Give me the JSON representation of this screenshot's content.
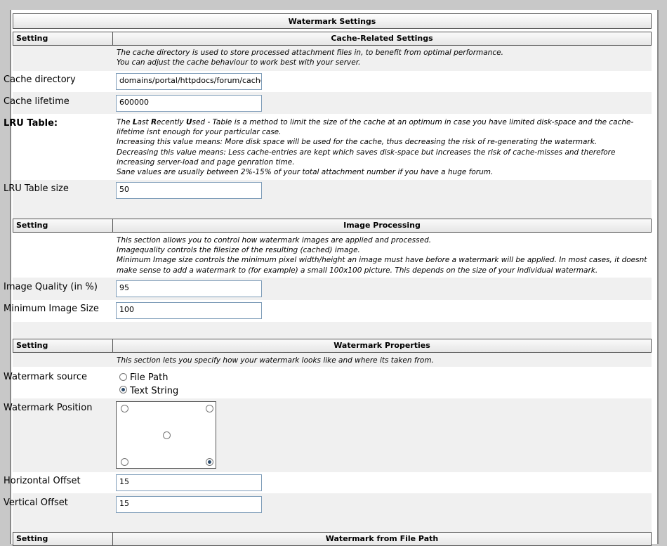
{
  "title": "Watermark Settings",
  "column_setting": "Setting",
  "cache": {
    "header": "Cache-Related Settings",
    "desc_line1": "The cache directory is used to store processed attachment files in, to benefit from optimal performance.",
    "desc_line2": "You can adjust the cache behaviour to work best with your server.",
    "dir_label": "Cache directory",
    "dir_value": "domains/portal/httpdocs/forum/cache",
    "lifetime_label": "Cache lifetime",
    "lifetime_value": "600000",
    "lru_label": "LRU Table:",
    "lru_desc_pre": "The ",
    "lru_l": "L",
    "lru_ast": "ast ",
    "lru_r": "R",
    "lru_ecently": "ecently ",
    "lru_u": "U",
    "lru_sed": "sed",
    "lru_desc_post": " - Table is a method to limit the size of the cache at an optimum in case you have limited disk-space and the cache-",
    "lru_line2": "lifetime isnt enough for your particular case.",
    "lru_line3": "Increasing this value means: More disk space will be used for the cache, thus decreasing the risk of re-generating the watermark.",
    "lru_line4": "Decreasing this value means: Less cache-entries are kept which saves disk-space but increases the risk of cache-misses and therefore",
    "lru_line5": "increasing server-load and page genration time.",
    "lru_line6": "Sane values are usually between 2%-15% of your total attachment number if you have a huge forum.",
    "lru_size_label": "LRU Table size",
    "lru_size_value": "50"
  },
  "image": {
    "header": "Image Processing",
    "desc_line1": "This section allows you to control how watermark images are applied and processed.",
    "desc_line2": "Imagequality controls the filesize of the resulting (cached) image.",
    "desc_line3": "Minimum Image size controls the minimum pixel width/height an image must have before a watermark will be applied. In most cases, it doesnt",
    "desc_line4": "make sense to add a watermark to (for example) a small 100x100 picture. This depends on the size of your individual watermark.",
    "quality_label": "Image Quality (in %)",
    "quality_value": "95",
    "minsize_label": "Minimum Image Size",
    "minsize_value": "100"
  },
  "props": {
    "header": "Watermark Properties",
    "desc": "This section lets you specify how your watermark looks like and where its taken from.",
    "source_label": "Watermark source",
    "source_options": [
      "File Path",
      "Text String"
    ],
    "source_selected": "Text String",
    "position_label": "Watermark Position",
    "position_selected": "bottom-right",
    "hoffset_label": "Horizontal Offset",
    "hoffset_value": "15",
    "voffset_label": "Vertical Offset",
    "voffset_value": "15"
  },
  "filepath": {
    "header": "Watermark from File Path"
  }
}
